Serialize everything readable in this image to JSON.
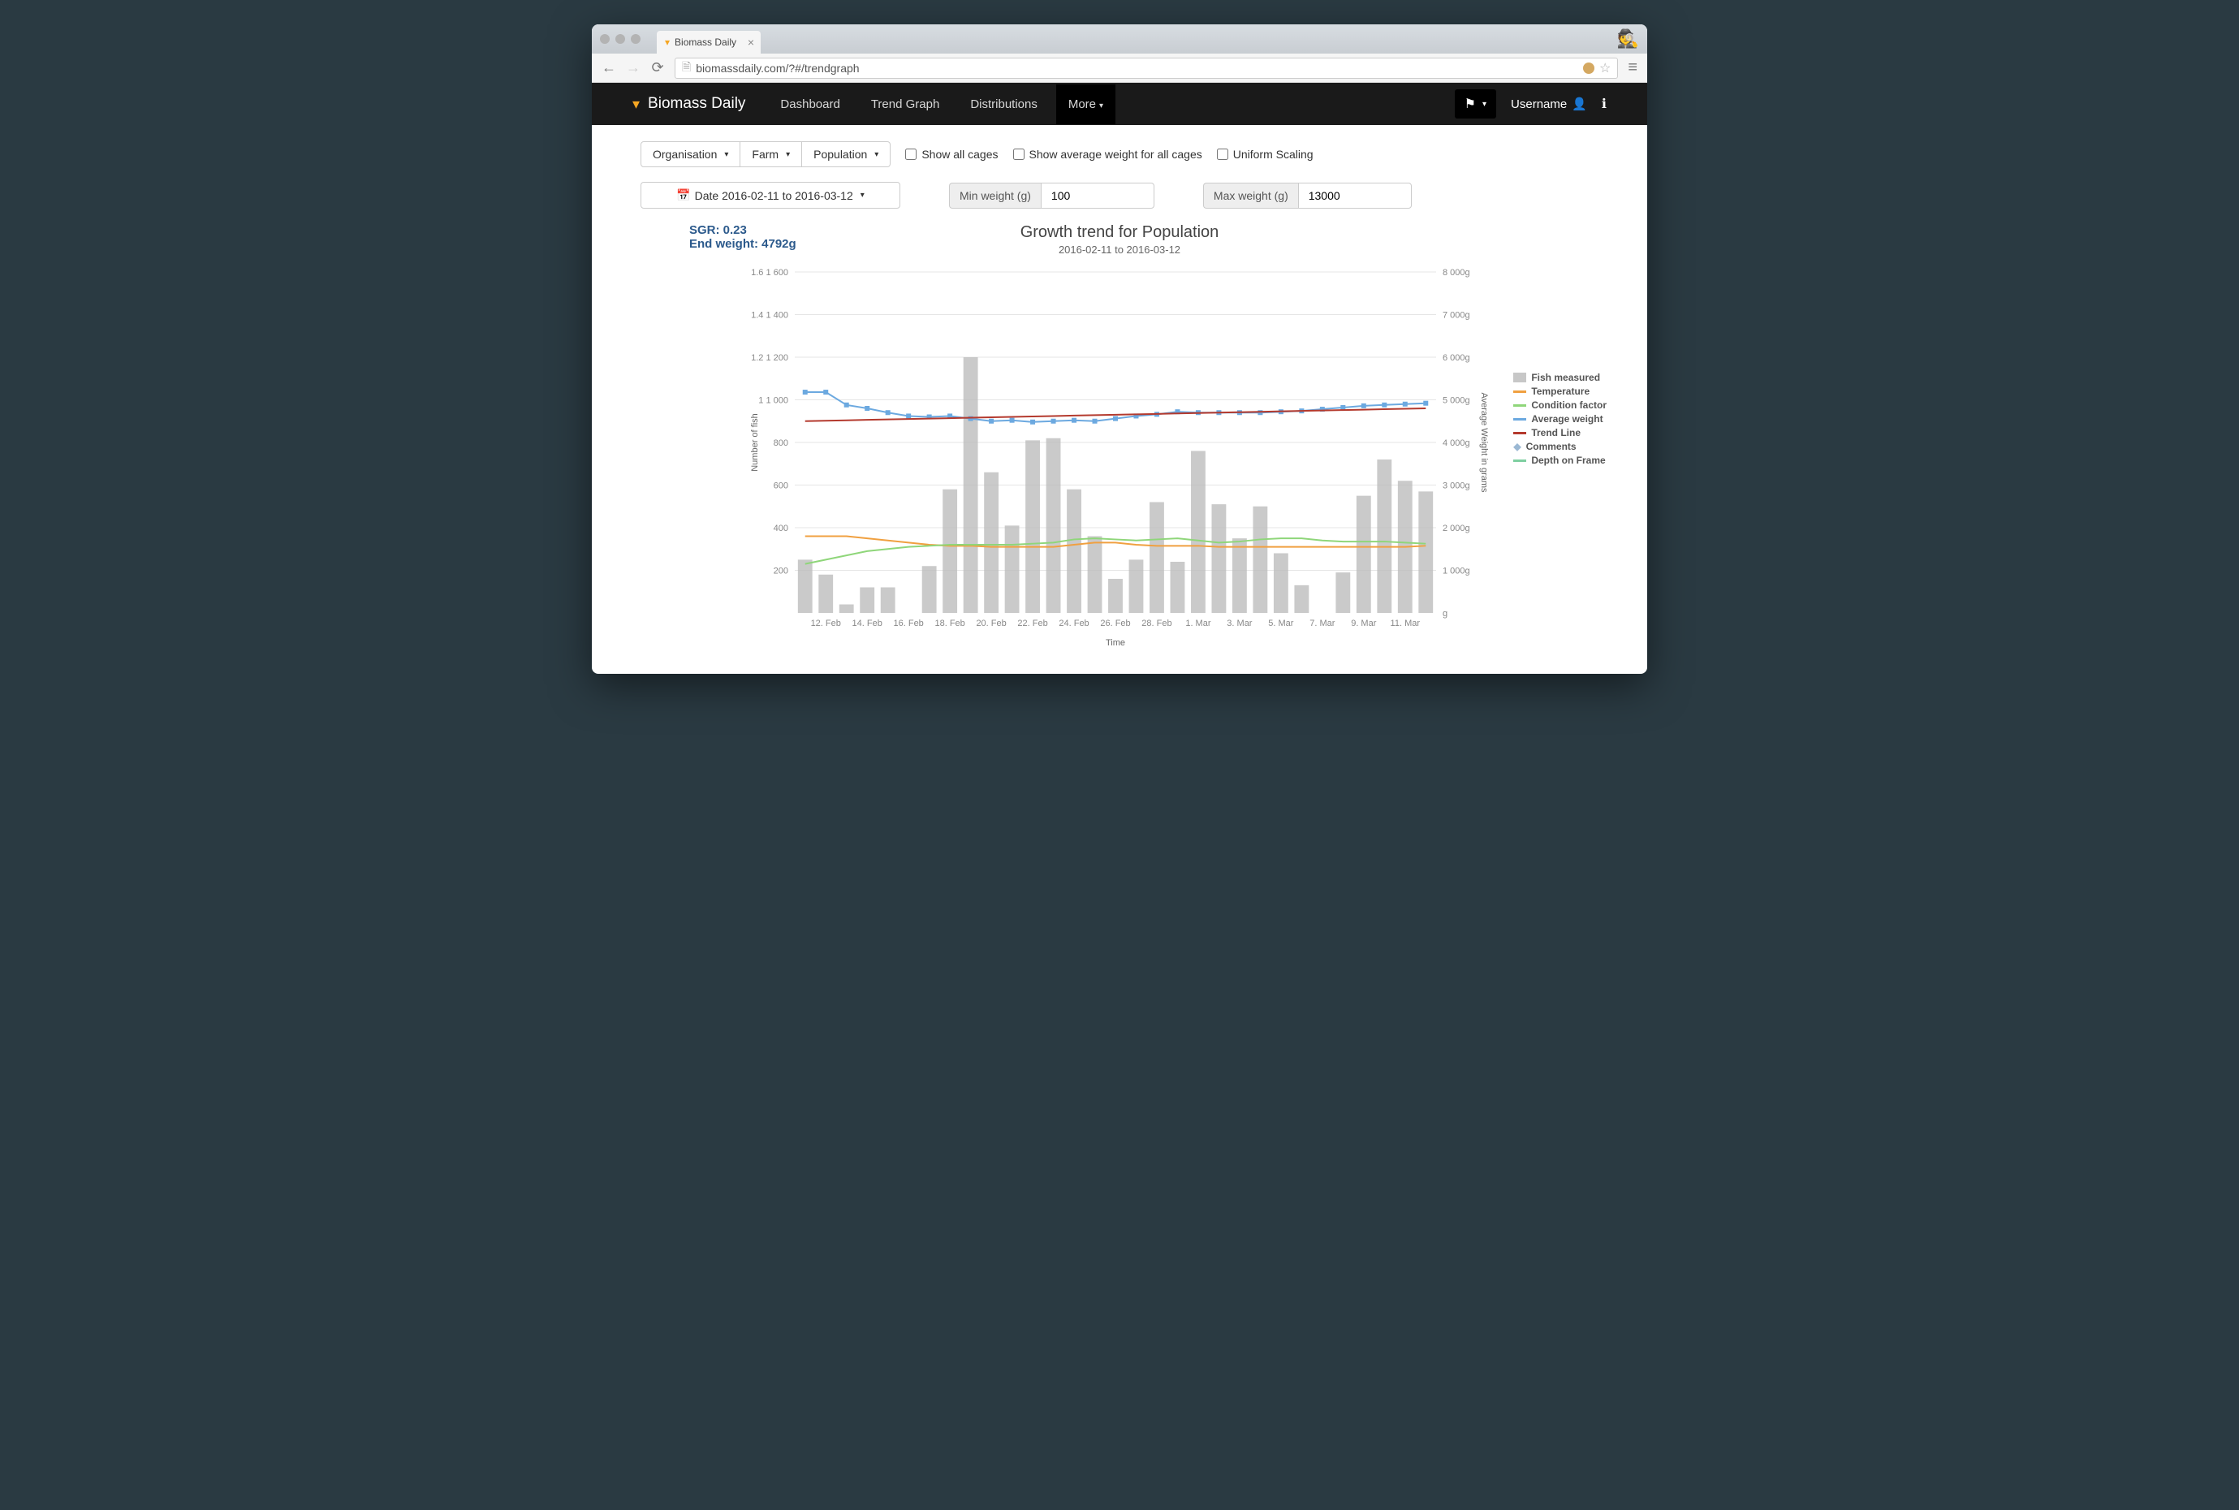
{
  "browser": {
    "tab_title": "Biomass Daily",
    "url": "biomassdaily.com/?#/trendgraph"
  },
  "nav": {
    "brand": "Biomass Daily",
    "links": [
      "Dashboard",
      "Trend Graph",
      "Distributions",
      "More"
    ],
    "username": "Username"
  },
  "filters": {
    "org": "Organisation",
    "farm": "Farm",
    "pop": "Population",
    "show_all": "Show all cages",
    "show_avg": "Show average weight for all cages",
    "uniform": "Uniform Scaling",
    "date": "Date 2016-02-11 to 2016-03-12",
    "minw_label": "Min weight (g)",
    "minw": "100",
    "maxw_label": "Max weight (g)",
    "maxw": "13000"
  },
  "summary": {
    "sgr": "SGR: 0.23",
    "end": "End weight: 4792g"
  },
  "chart_title": "Growth trend for Population",
  "chart_sub": "2016-02-11 to 2016-03-12",
  "y1_label": "Number of fish",
  "y2_label": "Average Weight in grams",
  "x_label": "Time",
  "legend": {
    "fish": "Fish measured",
    "temp": "Temperature",
    "cond": "Condition factor",
    "avg": "Average weight",
    "trend": "Trend Line",
    "comm": "Comments",
    "depth": "Depth on Frame"
  },
  "chart_data": {
    "type": "bar",
    "x_categories": [
      "11. Feb",
      "12. Feb",
      "13. Feb",
      "14. Feb",
      "15. Feb",
      "16. Feb",
      "17. Feb",
      "18. Feb",
      "19. Feb",
      "20. Feb",
      "21. Feb",
      "22. Feb",
      "23. Feb",
      "24. Feb",
      "25. Feb",
      "26. Feb",
      "27. Feb",
      "28. Feb",
      "29. Feb",
      "1. Mar",
      "2. Mar",
      "3. Mar",
      "4. Mar",
      "5. Mar",
      "6. Mar",
      "7. Mar",
      "8. Mar",
      "9. Mar",
      "10. Mar",
      "11. Mar",
      "12. Mar"
    ],
    "x_ticks_shown": [
      "12. Feb",
      "14. Feb",
      "16. Feb",
      "18. Feb",
      "20. Feb",
      "22. Feb",
      "24. Feb",
      "26. Feb",
      "28. Feb",
      "1. Mar",
      "3. Mar",
      "5. Mar",
      "7. Mar",
      "9. Mar",
      "11. Mar"
    ],
    "y_left": {
      "label": "Number of fish",
      "min": 0,
      "max": 1600,
      "ticks": [
        200,
        400,
        600,
        800,
        1000,
        1200,
        1400,
        1600
      ]
    },
    "y_right": {
      "label": "Average Weight in grams",
      "min": 0,
      "max": 8000,
      "ticks": [
        "g",
        "1 000g",
        "2 000g",
        "3 000g",
        "4 000g",
        "5 000g",
        "6 000g",
        "7 000g",
        "8 000g"
      ]
    },
    "series": [
      {
        "name": "Fish measured",
        "type": "bar",
        "axis": "left",
        "color": "#b8b8b8",
        "values": [
          250,
          180,
          40,
          120,
          120,
          null,
          220,
          580,
          1200,
          660,
          410,
          810,
          820,
          580,
          360,
          160,
          250,
          520,
          240,
          760,
          510,
          350,
          500,
          280,
          130,
          null,
          190,
          550,
          720,
          620,
          570
        ]
      },
      {
        "name": "Average weight",
        "type": "line",
        "axis": "right",
        "color": "#6ca9e0",
        "values": [
          5180,
          5180,
          4880,
          4800,
          4700,
          4620,
          4600,
          4620,
          4560,
          4500,
          4520,
          4480,
          4500,
          4520,
          4500,
          4560,
          4620,
          4660,
          4720,
          4700,
          4700,
          4700,
          4700,
          4720,
          4740,
          4780,
          4820,
          4860,
          4880,
          4900,
          4920
        ]
      },
      {
        "name": "Trend Line",
        "type": "line",
        "axis": "right",
        "color": "#b43a2e",
        "values": [
          4500,
          4510,
          4520,
          4530,
          4540,
          4550,
          4560,
          4570,
          4580,
          4590,
          4600,
          4610,
          4620,
          4630,
          4640,
          4650,
          4660,
          4670,
          4680,
          4690,
          4700,
          4710,
          4720,
          4730,
          4740,
          4750,
          4760,
          4770,
          4780,
          4790,
          4800
        ]
      },
      {
        "name": "Temperature",
        "type": "line",
        "axis": "left",
        "color": "#f0a040",
        "values": [
          360,
          360,
          360,
          350,
          340,
          330,
          320,
          315,
          315,
          310,
          310,
          310,
          310,
          320,
          330,
          330,
          320,
          315,
          315,
          315,
          310,
          310,
          310,
          310,
          310,
          310,
          310,
          310,
          310,
          310,
          315
        ]
      },
      {
        "name": "Condition factor",
        "type": "line",
        "axis": "left",
        "color": "#8fd67a",
        "values": [
          230,
          250,
          270,
          290,
          300,
          310,
          315,
          320,
          320,
          320,
          320,
          325,
          330,
          345,
          350,
          345,
          340,
          345,
          350,
          340,
          330,
          335,
          345,
          350,
          350,
          340,
          335,
          335,
          335,
          330,
          325
        ]
      },
      {
        "name": "Depth on Frame",
        "type": "line",
        "axis": "left",
        "color": "#7ecfa0",
        "values": null
      },
      {
        "name": "Comments",
        "type": "scatter",
        "axis": "left",
        "color": "#9bb8d3",
        "values": null
      }
    ]
  }
}
